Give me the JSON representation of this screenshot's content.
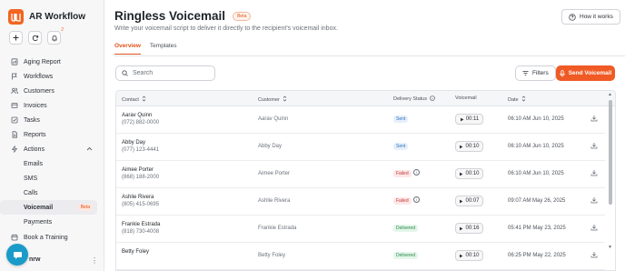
{
  "app": {
    "name": "AR Workflow"
  },
  "notifications": {
    "count": "2"
  },
  "sidebar": {
    "items": [
      {
        "label": "Aging Report",
        "icon": "report-icon"
      },
      {
        "label": "Workflows",
        "icon": "flag-icon"
      },
      {
        "label": "Customers",
        "icon": "users-icon"
      },
      {
        "label": "Invoices",
        "icon": "invoice-icon"
      },
      {
        "label": "Tasks",
        "icon": "tasks-icon"
      },
      {
        "label": "Reports",
        "icon": "reports-icon"
      },
      {
        "label": "Actions",
        "icon": "bolt-icon"
      }
    ],
    "sub_items": [
      {
        "label": "Emails"
      },
      {
        "label": "SMS"
      },
      {
        "label": "Calls"
      },
      {
        "label": "Voicemail",
        "badge": "Beta"
      },
      {
        "label": "Payments"
      }
    ],
    "book_training": "Book a Training",
    "user_label": "nrw"
  },
  "page": {
    "title": "Ringless Voicemail",
    "beta": "Beta",
    "subtitle": "Write your voicemail script to deliver it directly to the recipient's voicemail inbox.",
    "how_it_works": "How it works"
  },
  "tabs": [
    {
      "label": "Overview"
    },
    {
      "label": "Templates"
    }
  ],
  "search": {
    "placeholder": "Search"
  },
  "toolbar": {
    "filters": "Filters",
    "send": "Send Voicemail"
  },
  "table": {
    "headers": {
      "contact": "Contact",
      "customer": "Customer",
      "status": "Delivery Status",
      "voicemail": "Voicemail",
      "date": "Date"
    },
    "rows": [
      {
        "name": "Aarav Quinn",
        "phone": "(072) 882-0000",
        "customer": "Aarav Quinn",
        "status": "Sent",
        "duration": "00:11",
        "date": "06:10 AM Jun 10, 2025"
      },
      {
        "name": "Abby Day",
        "phone": "(077) 123-4441",
        "customer": "Abby Day",
        "status": "Sent",
        "duration": "00:10",
        "date": "06:10 AM Jun 10, 2025"
      },
      {
        "name": "Aimee Porter",
        "phone": "(868) 188-2000",
        "customer": "Aimee Porter",
        "status": "Failed",
        "duration": "00:10",
        "date": "06:10 AM Jun 10, 2025"
      },
      {
        "name": "Ashlie Rivera",
        "phone": "(805) 415-0695",
        "customer": "Ashlie Rivera",
        "status": "Failed",
        "duration": "00:07",
        "date": "09:07 AM May 26, 2025"
      },
      {
        "name": "Frankie Estrada",
        "phone": "(818) 730-4008",
        "customer": "Frankie Estrada",
        "status": "Delivered",
        "duration": "00:16",
        "date": "05:41 PM May 23, 2025"
      },
      {
        "name": "Betty Foley",
        "phone": "",
        "customer": "Betty Foley",
        "status": "Delivered",
        "duration": "00:10",
        "date": "06:25 PM May 22, 2025"
      }
    ]
  },
  "colors": {
    "accent": "#f05a24",
    "chat": "#1a9bc8"
  }
}
